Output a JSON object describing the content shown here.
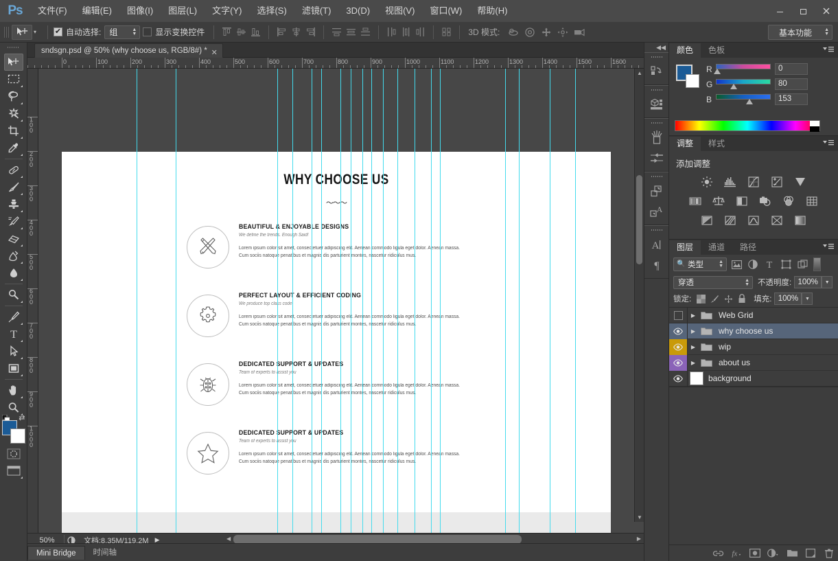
{
  "app": {
    "logo": "Ps"
  },
  "menubar": {
    "items": [
      {
        "label": "文件(F)"
      },
      {
        "label": "编辑(E)"
      },
      {
        "label": "图像(I)"
      },
      {
        "label": "图层(L)"
      },
      {
        "label": "文字(Y)"
      },
      {
        "label": "选择(S)"
      },
      {
        "label": "滤镜(T)"
      },
      {
        "label": "3D(D)"
      },
      {
        "label": "视图(V)"
      },
      {
        "label": "窗口(W)"
      },
      {
        "label": "帮助(H)"
      }
    ],
    "window_buttons": {
      "minimize": "—",
      "maximize": "▭",
      "close": "✕"
    }
  },
  "options_bar": {
    "auto_select_label": "自动选择:",
    "auto_select_checked": "✔",
    "auto_select_value": "组",
    "show_transform_label": "显示变换控件",
    "show_transform_checked": "",
    "three_d_mode_label": "3D 模式:",
    "workspace": "基本功能"
  },
  "document_tab": {
    "title": "sndsgn.psd @ 50% (why choose us, RGB/8#) *",
    "close": "✕"
  },
  "rulers": {
    "h_labels": [
      "0",
      "100",
      "200",
      "300",
      "400",
      "500",
      "600",
      "700",
      "800",
      "900",
      "1000",
      "1100",
      "1200",
      "1300",
      "1400",
      "1500",
      "1600"
    ],
    "v_labels": [
      "100",
      "200",
      "300",
      "400",
      "500",
      "600",
      "700",
      "800",
      "900",
      "1000"
    ]
  },
  "canvas": {
    "title": "WHY CHOOSE US",
    "squiggle": "〜〜〜",
    "features": [
      {
        "icon": "crossed-pencil-ruler-icon",
        "heading": "BEAUTIFUL & ENJOYABLE DESIGNS",
        "subheading": "We define the trends. Enough Said!",
        "body": "Lorem ipsum color sit amet, consectetuer adipiscing elit. Aenean commodo ligula eget dolor. Aenean massa. Cum sociis natoque penatibus et magnis dis parturient montes, nascetur ridiculus mus."
      },
      {
        "icon": "gear-icon",
        "heading": "PERFECT LAYOUT & EFFICIENT CODING",
        "subheading": "We produce top class code",
        "body": "Lorem ipsum color sit amet, consectetuer adipiscing elit. Aenean commodo ligula eget dolor. Aenean massa. Cum sociis natoque penatibus et magnis dis parturient montes, nascetur ridiculus mus."
      },
      {
        "icon": "bug-icon",
        "heading": "DEDICATED SUPPORT & UPDATES",
        "subheading": "Team of experts to assist you",
        "body": "Lorem ipsum color sit amet, consectetuer adipiscing elit. Aenean commodo ligula eget dolor. Aenean massa. Cum sociis natoque penatibus et magnis dis parturient montes, nascetur ridiculus mus."
      },
      {
        "icon": "star-icon",
        "heading": "DEDICATED SUPPORT & UPDATES",
        "subheading": "Team of experts to assist you",
        "body": "Lorem ipsum color sit amet, consectetuer adipiscing elit. Aenean commodo ligula eget dolor. Aenean massa. Cum sociis natoque penatibus et magnis dis parturient montes, nascetur ridiculus mus."
      }
    ],
    "guide_color": "#43dbed",
    "guide_positions": [
      143,
      200,
      348,
      370,
      398,
      412,
      440,
      455,
      472,
      485,
      502,
      523,
      548,
      572,
      585,
      680,
      700,
      745,
      782
    ]
  },
  "status_bar": {
    "zoom": "50%",
    "doc_info": "文档:8.35M/119.2M",
    "arrow": "▶"
  },
  "bottom_tabs": [
    {
      "label": "Mini Bridge",
      "active": true
    },
    {
      "label": "时间轴",
      "active": false
    }
  ],
  "color_panel": {
    "tabs": [
      {
        "label": "颜色",
        "active": true
      },
      {
        "label": "色板",
        "active": false
      }
    ],
    "foreground": "#1b5b96",
    "background": "#ffffff",
    "channels": [
      {
        "name": "R",
        "value": "0",
        "knob_pct": 2
      },
      {
        "name": "G",
        "value": "80",
        "knob_pct": 31
      },
      {
        "name": "B",
        "value": "153",
        "knob_pct": 60
      }
    ]
  },
  "adjustments_panel": {
    "tabs": [
      {
        "label": "调整",
        "active": true
      },
      {
        "label": "样式",
        "active": false
      }
    ],
    "title": "添加调整",
    "icons": [
      "brightness-contrast-icon",
      "levels-icon",
      "curves-icon",
      "exposure-icon",
      "vibrance-icon",
      "hue-saturation-icon",
      "color-balance-icon",
      "black-white-icon",
      "photo-filter-icon",
      "channel-mixer-icon",
      "color-lookup-icon",
      "invert-icon",
      "posterize-icon",
      "threshold-icon",
      "selective-color-icon",
      "gradient-map-icon"
    ]
  },
  "layers_panel": {
    "tabs": [
      {
        "label": "图层",
        "active": true
      },
      {
        "label": "通道",
        "active": false
      },
      {
        "label": "路径",
        "active": false
      }
    ],
    "filter_value": "类型",
    "filter_icons": [
      "pixel-filter-icon",
      "adjustment-filter-icon",
      "type-filter-icon",
      "shape-filter-icon",
      "smartobject-filter-icon"
    ],
    "blend_mode": "穿透",
    "opacity_label": "不透明度:",
    "opacity_value": "100%",
    "lock_label": "锁定:",
    "lock_icons": [
      "lock-transparency-icon",
      "lock-image-icon",
      "lock-position-icon",
      "lock-all-icon"
    ],
    "fill_label": "填充:",
    "fill_value": "100%",
    "layers": [
      {
        "name": "Web Grid",
        "type": "group",
        "visible": false,
        "selected": false,
        "color": "none"
      },
      {
        "name": "why choose us",
        "type": "group",
        "visible": true,
        "selected": true,
        "color": "blue"
      },
      {
        "name": "wip",
        "type": "group",
        "visible": true,
        "selected": false,
        "color": "gold"
      },
      {
        "name": "about us",
        "type": "group",
        "visible": true,
        "selected": false,
        "color": "purple"
      },
      {
        "name": "background",
        "type": "layer",
        "visible": true,
        "selected": false,
        "color": "none"
      }
    ],
    "footer_icons": [
      "link-layers-icon",
      "layer-style-fx-icon",
      "layer-mask-icon",
      "adjustment-layer-icon",
      "new-group-icon",
      "new-layer-icon",
      "delete-layer-icon"
    ]
  },
  "tool_rail": {
    "collapse": "◀◀",
    "icons": [
      "history-icon",
      "3d-icon",
      "brush-presets-icon",
      "brush-panel-icon",
      "clone-source-icon",
      "layer-comps-icon",
      "character-styles-icon",
      "character-icon",
      "paragraph-icon"
    ]
  },
  "toolbar": {
    "tools": [
      {
        "name": "move-tool",
        "selected": true
      },
      {
        "name": "marquee-tool",
        "selected": false
      },
      {
        "name": "lasso-tool",
        "selected": false
      },
      {
        "name": "magic-wand-tool",
        "selected": false
      },
      {
        "name": "crop-tool",
        "selected": false
      },
      {
        "name": "eyedropper-tool",
        "selected": false
      },
      {
        "name": "healing-brush-tool",
        "selected": false
      },
      {
        "name": "brush-tool",
        "selected": false
      },
      {
        "name": "clone-stamp-tool",
        "selected": false
      },
      {
        "name": "history-brush-tool",
        "selected": false
      },
      {
        "name": "eraser-tool",
        "selected": false
      },
      {
        "name": "gradient-tool",
        "selected": false
      },
      {
        "name": "blur-tool",
        "selected": false
      },
      {
        "name": "dodge-tool",
        "selected": false
      },
      {
        "name": "pen-tool",
        "selected": false
      },
      {
        "name": "type-tool",
        "selected": false
      },
      {
        "name": "path-selection-tool",
        "selected": false
      },
      {
        "name": "rectangle-tool",
        "selected": false
      },
      {
        "name": "hand-tool",
        "selected": false
      },
      {
        "name": "zoom-tool",
        "selected": false
      }
    ],
    "type_tool_glyph": "T",
    "foreground_color": "#1b5b96",
    "background_color": "#ffffff"
  }
}
